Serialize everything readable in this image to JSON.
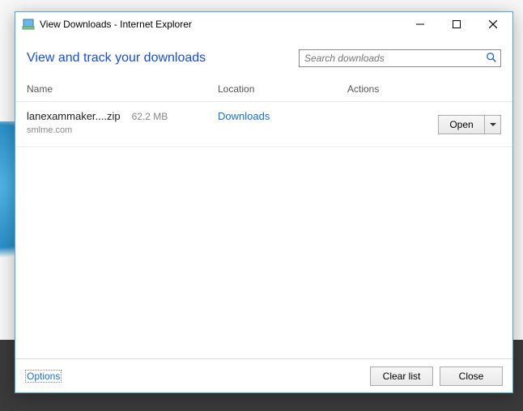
{
  "window": {
    "title": "View Downloads - Internet Explorer"
  },
  "heading": "View and track your downloads",
  "search": {
    "placeholder": "Search downloads"
  },
  "columns": {
    "name": "Name",
    "location": "Location",
    "actions": "Actions"
  },
  "downloads": [
    {
      "filename": "lanexammaker....zip",
      "size": "62.2 MB",
      "source": "smlme.com",
      "location": "Downloads",
      "action_label": "Open"
    }
  ],
  "footer": {
    "options": "Options",
    "clear_list": "Clear list",
    "close": "Close"
  }
}
